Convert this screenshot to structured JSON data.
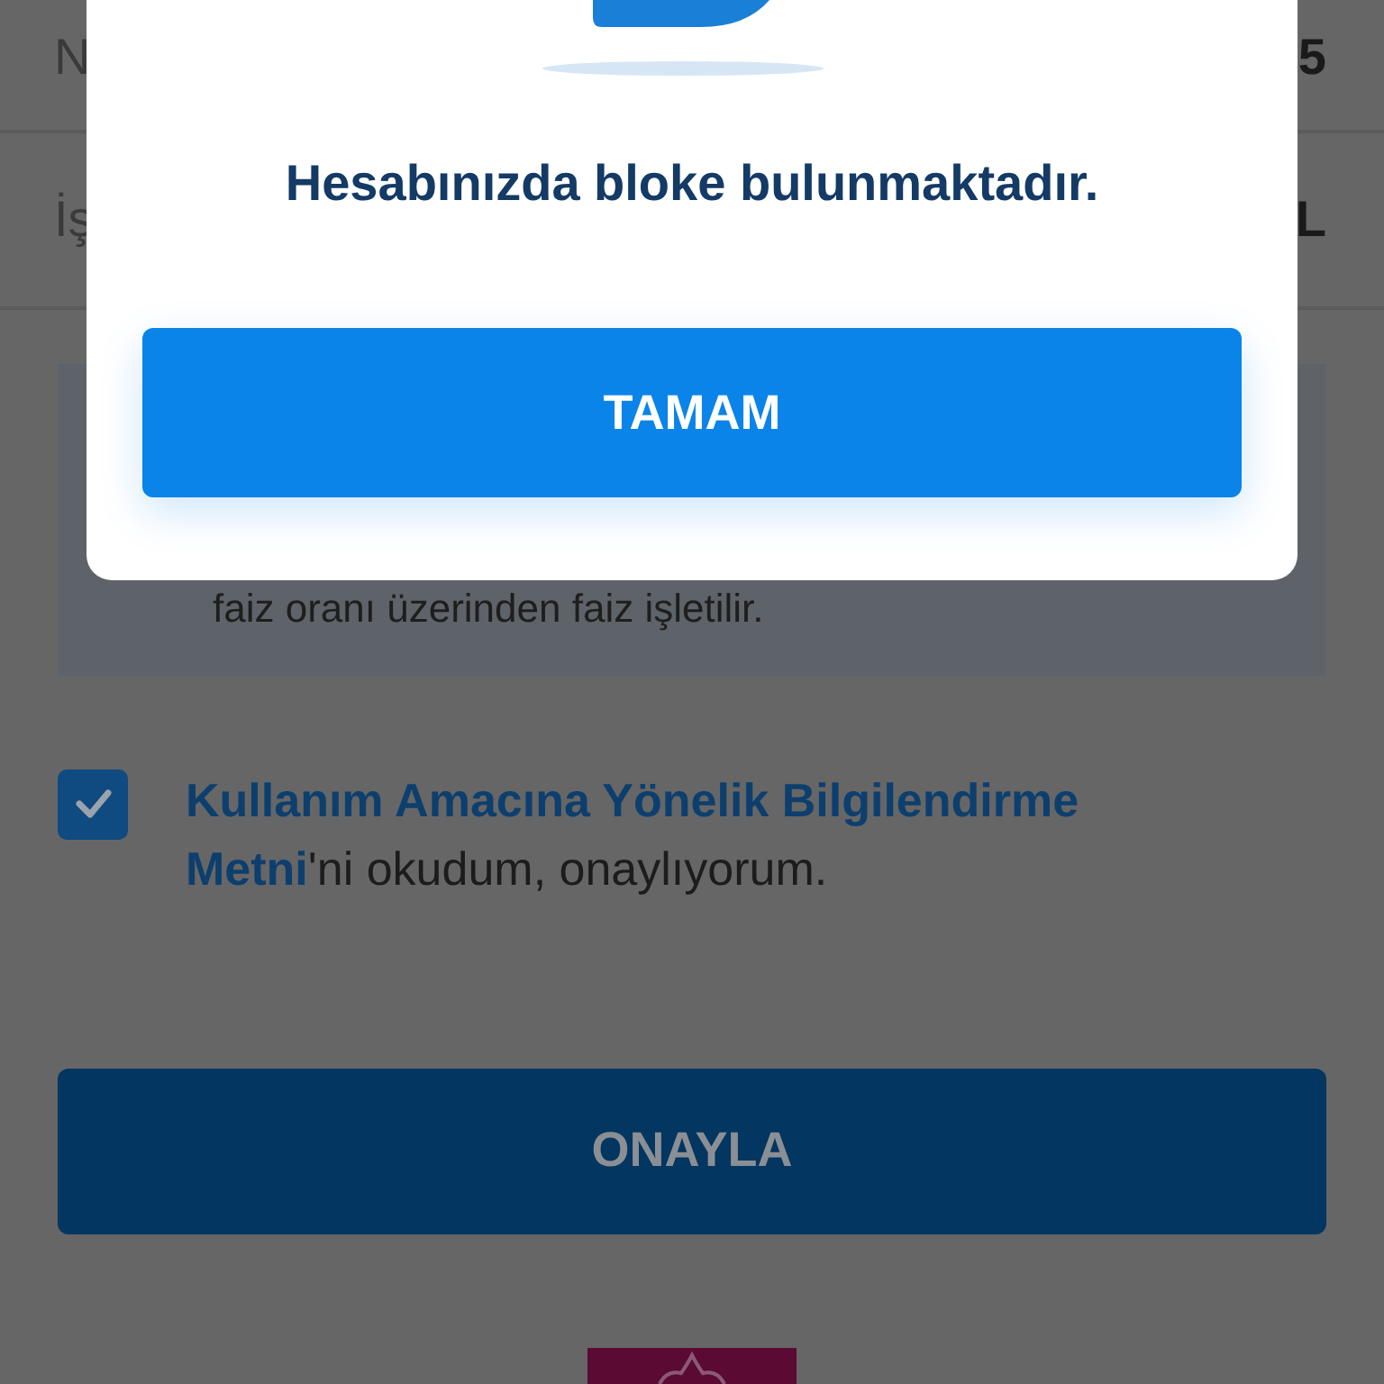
{
  "background": {
    "rows": [
      {
        "label": "N",
        "value": "5"
      },
      {
        "label": "İş",
        "value": "L"
      }
    ],
    "info_text": "faiz oranı üzerinden faiz işletilir.",
    "consent": {
      "checked": true,
      "text": "**Kullanım Amacına Yönelik Bilgilendirme Metni**'ni okudum, onaylıyorum."
    },
    "confirm_button": {
      "label": "ONAYLA",
      "disabled": true
    }
  },
  "dialog": {
    "message": "Hesabınızda bloke bulunmaktadır.",
    "button": "TAMAM"
  }
}
